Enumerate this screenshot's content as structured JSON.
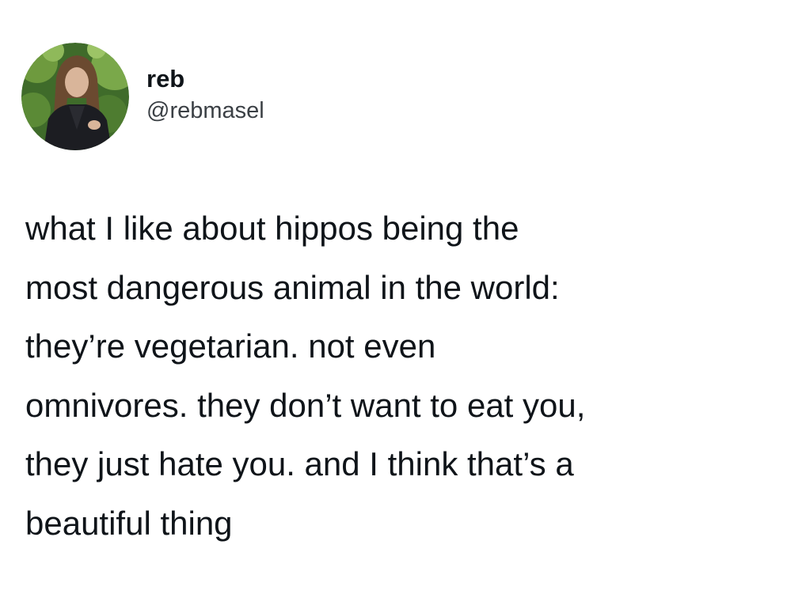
{
  "author": {
    "display_name": "reb",
    "handle": "@rebmasel",
    "avatar_icon": "profile-photo-icon"
  },
  "tweet": {
    "lines": [
      "what I like about hippos being the",
      "most dangerous animal in the world:",
      "they’re vegetarian. not even",
      "omnivores. they don’t want to eat you,",
      "they just hate you. and I think that’s a",
      "beautiful thing"
    ]
  },
  "colors": {
    "background": "#ffffff",
    "text": "#0f1419",
    "handle": "#3b4045"
  }
}
